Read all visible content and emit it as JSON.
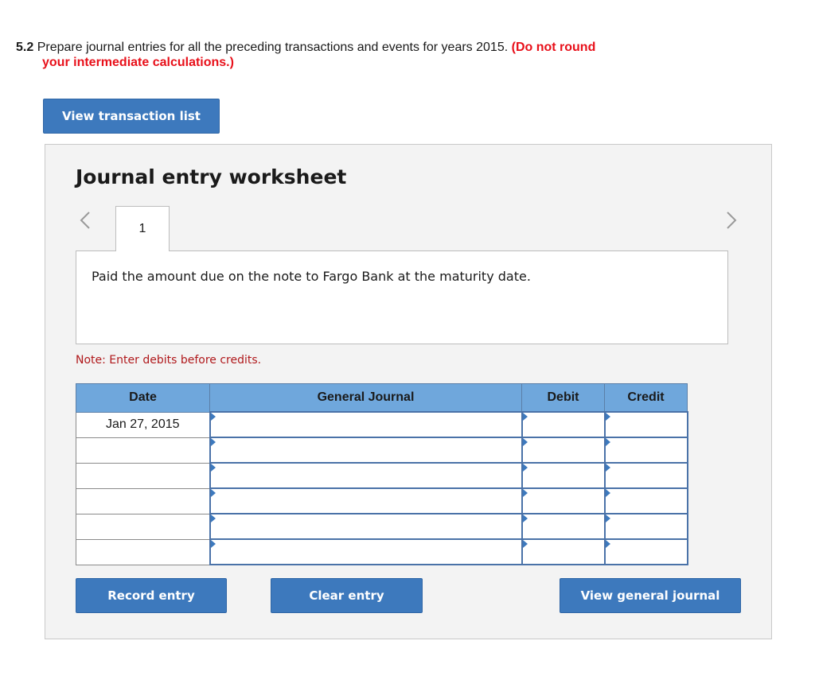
{
  "question": {
    "number": "5.2",
    "text": "Prepare journal entries for all the preceding transactions and events for years 2015.",
    "warning_line1": "(Do not round",
    "warning_line2": "your intermediate calculations.)"
  },
  "buttons": {
    "view_transaction_list": "View transaction list",
    "record_entry": "Record entry",
    "clear_entry": "Clear entry",
    "view_general_journal": "View general journal"
  },
  "worksheet": {
    "title": "Journal entry worksheet",
    "active_tab": "1",
    "description": "Paid the amount due on the note to Fargo Bank at the maturity date.",
    "note": "Note: Enter debits before credits."
  },
  "icons": {
    "prev": "chevron-left-icon",
    "next": "chevron-right-icon",
    "dropdown_marker": "dropdown-triangle-icon"
  },
  "journal": {
    "headers": {
      "date": "Date",
      "general_journal": "General Journal",
      "debit": "Debit",
      "credit": "Credit"
    },
    "rows": [
      {
        "date": "Jan 27, 2015",
        "account": "",
        "debit": "",
        "credit": ""
      },
      {
        "date": "",
        "account": "",
        "debit": "",
        "credit": ""
      },
      {
        "date": "",
        "account": "",
        "debit": "",
        "credit": ""
      },
      {
        "date": "",
        "account": "",
        "debit": "",
        "credit": ""
      },
      {
        "date": "",
        "account": "",
        "debit": "",
        "credit": ""
      },
      {
        "date": "",
        "account": "",
        "debit": "",
        "credit": ""
      }
    ]
  },
  "colors": {
    "accent_button": "#3d79bd",
    "table_header": "#6fa7dc",
    "warning_text": "#e8101a",
    "note_text": "#b0181b"
  }
}
